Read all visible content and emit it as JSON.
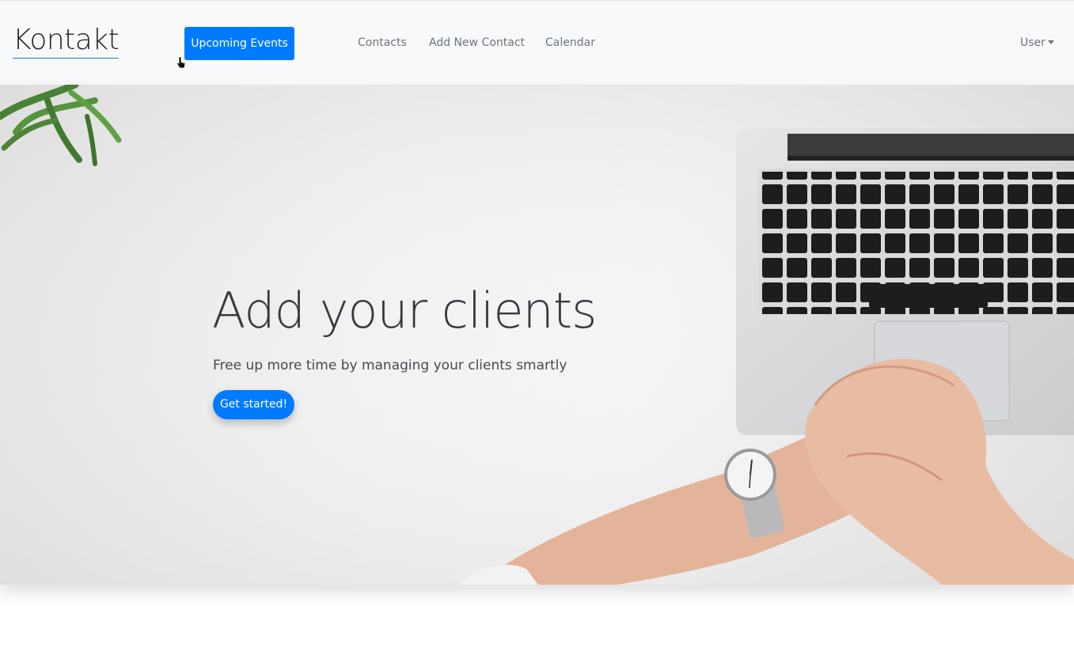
{
  "navbar": {
    "brand": "Kontakt",
    "upcoming_events": "Upcoming Events",
    "links": [
      "Contacts",
      "Add New Contact",
      "Calendar"
    ],
    "user_menu": "User"
  },
  "hero": {
    "title": "Add your clients",
    "subtitle": "Free up more time by managing your clients smartly",
    "cta": "Get started!"
  },
  "colors": {
    "primary": "#007bff",
    "navbar_bg": "#f8f9fa",
    "nav_link": "#6c757d"
  },
  "icons": [
    "pointer-cursor-icon",
    "dropdown-caret-icon"
  ]
}
